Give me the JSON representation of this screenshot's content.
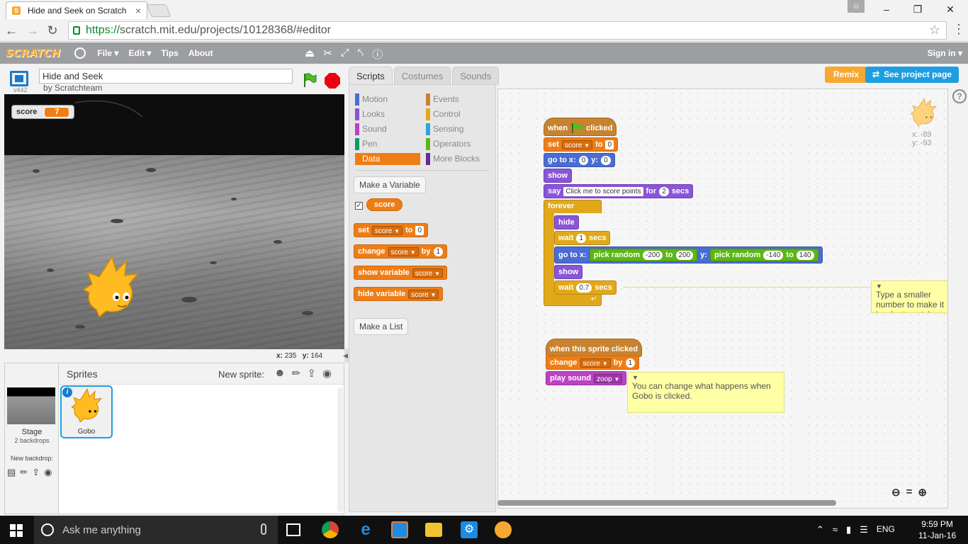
{
  "browser": {
    "tab_title": "Hide and Seek on Scratch",
    "url_https": "https://",
    "url_rest": "scratch.mit.edu/projects/10128368/#editor"
  },
  "menubar": {
    "logo": "SCRATCH",
    "file": "File ▾",
    "edit": "Edit ▾",
    "tips": "Tips",
    "about": "About",
    "sign_in": "Sign in ▾"
  },
  "project": {
    "version": "v442",
    "title": "Hide and Seek",
    "byline": "by Scratchteam",
    "remix": "Remix",
    "see_project_page": "See project page"
  },
  "stage": {
    "monitor_label": "score",
    "monitor_value": "7",
    "x_label": "x:",
    "x_value": "235",
    "y_label": "y:",
    "y_value": "164"
  },
  "sprites": {
    "title": "Sprites",
    "new_sprite": "New sprite:",
    "stage_label": "Stage",
    "backdrops": "2 backdrops",
    "new_backdrop": "New backdrop:",
    "sprite_name": "Gobo"
  },
  "tabs": [
    "Scripts",
    "Costumes",
    "Sounds"
  ],
  "categories": [
    {
      "label": "Motion",
      "color": "#4a6cd4"
    },
    {
      "label": "Looks",
      "color": "#8a55d7"
    },
    {
      "label": "Sound",
      "color": "#bb42c3"
    },
    {
      "label": "Pen",
      "color": "#0e9a6c"
    },
    {
      "label": "Data",
      "color": "#ee7d16"
    },
    {
      "label": "Events",
      "color": "#c88330"
    },
    {
      "label": "Control",
      "color": "#e1a91a"
    },
    {
      "label": "Sensing",
      "color": "#2ca5e2"
    },
    {
      "label": "Operators",
      "color": "#5cb712"
    },
    {
      "label": "More Blocks",
      "color": "#632d99"
    }
  ],
  "palette": {
    "make_variable": "Make a Variable",
    "variable_name": "score",
    "set_block": {
      "set": "set",
      "var": "score",
      "to": "to",
      "value": "0"
    },
    "change_block": {
      "change": "change",
      "var": "score",
      "by": "by",
      "value": "1"
    },
    "show_var_block": {
      "label": "show variable",
      "var": "score"
    },
    "hide_var_block": {
      "label": "hide variable",
      "var": "score"
    },
    "make_list": "Make a List"
  },
  "script1": {
    "when": "when",
    "clicked": "clicked",
    "set": "set",
    "set_var": "score",
    "set_to": "to",
    "set_val": "0",
    "goto": "go to x:",
    "goto_x": "0",
    "goto_y_label": "y:",
    "goto_y": "0",
    "show": "show",
    "say": "say",
    "say_text": "Click me to score points",
    "say_for": "for",
    "say_secs_val": "2",
    "say_secs": "secs",
    "forever": "forever",
    "hide": "hide",
    "wait": "wait",
    "wait1_val": "1",
    "secs": "secs",
    "goto2": "go to x:",
    "pick_random": "pick random",
    "r1_from": "-200",
    "to": "to",
    "r1_to": "200",
    "y_label": "y:",
    "r2_from": "-140",
    "r2_to": "140",
    "show2": "show",
    "wait2_val": "0.7"
  },
  "script2": {
    "hat": "when this sprite clicked",
    "change": "change",
    "var": "score",
    "by": "by",
    "val": "1",
    "play_sound": "play sound",
    "sound_name": "zoop"
  },
  "comments": {
    "c1": "Type a smaller number to make it harder to catch Gobo.",
    "c2": "You can change what happens when Gobo is clicked."
  },
  "sprite_preview": {
    "x_label": "x:",
    "x": "-89",
    "y_label": "y:",
    "y": "-93"
  },
  "taskbar": {
    "search": "Ask me anything",
    "lang": "ENG",
    "time": "9:59 PM",
    "date": "11-Jan-16"
  }
}
